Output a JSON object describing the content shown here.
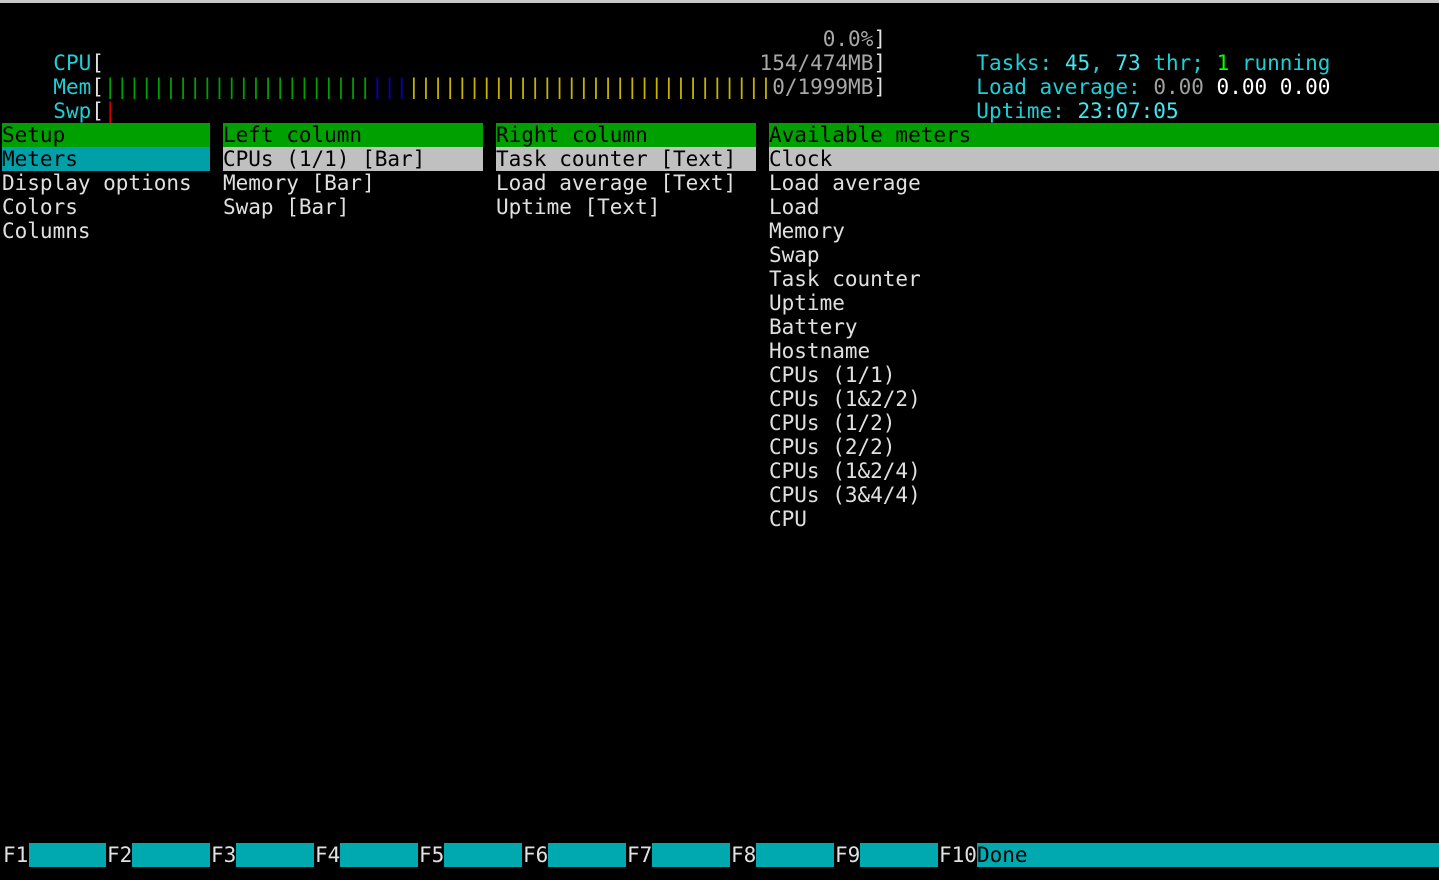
{
  "meters": {
    "cpu": {
      "label": "CPU",
      "value": "0.0%"
    },
    "mem": {
      "label": "Mem",
      "value": "154/474MB",
      "bars_green": "||||||||||||||||||||||",
      "bars_blue": "|||",
      "bars_yellow": "||||||||||||||||||||||||||||||"
    },
    "swp": {
      "label": "Swp",
      "value": "0/1999MB",
      "bars_red": "|"
    }
  },
  "summary": {
    "tasks_label": "Tasks: ",
    "tasks_count": "45",
    "tasks_sep": ", ",
    "threads": "73",
    "threads_label": " thr; ",
    "running_count": "1",
    "running_label": " running",
    "load_label": "Load average: ",
    "load1": "0.00",
    "load5": "0.00",
    "load15": "0.00",
    "uptime_label": "Uptime: ",
    "uptime": "23:07:05"
  },
  "setup": {
    "header": "Setup",
    "items": [
      "Meters",
      "Display options",
      "Colors",
      "Columns"
    ]
  },
  "left_column": {
    "header": "Left column",
    "items": [
      "CPUs (1/1) [Bar]",
      "Memory [Bar]",
      "Swap [Bar]"
    ]
  },
  "right_column": {
    "header": "Right column",
    "items": [
      "Task counter [Text]",
      "Load average [Text]",
      "Uptime [Text]"
    ]
  },
  "available_meters": {
    "header": "Available meters",
    "items": [
      "Clock",
      "Load average",
      "Load",
      "Memory",
      "Swap",
      "Task counter",
      "Uptime",
      "Battery",
      "Hostname",
      "CPUs (1/1)",
      "CPUs (1&2/2)",
      "CPUs (1/2)",
      "CPUs (2/2)",
      "CPUs (1&2/4)",
      "CPUs (3&4/4)",
      "CPU"
    ]
  },
  "function_keys": [
    {
      "key": "F1",
      "label": ""
    },
    {
      "key": "F2",
      "label": ""
    },
    {
      "key": "F3",
      "label": ""
    },
    {
      "key": "F4",
      "label": ""
    },
    {
      "key": "F5",
      "label": ""
    },
    {
      "key": "F6",
      "label": ""
    },
    {
      "key": "F7",
      "label": ""
    },
    {
      "key": "F8",
      "label": ""
    },
    {
      "key": "F9",
      "label": ""
    },
    {
      "key": "F10",
      "label": "Done"
    }
  ]
}
